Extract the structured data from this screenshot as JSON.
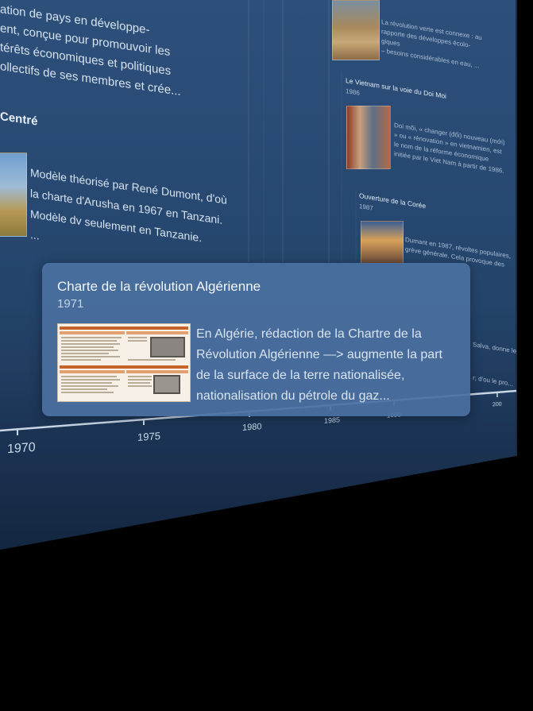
{
  "background_text": {
    "intro_lines": [
      "ation de pays en développe-",
      "ent, conçue pour promouvoir les",
      "térêts économiques et politiques",
      "ollectifs de ses membres et crée..."
    ],
    "section_heading": "Centré",
    "ujamaa_lines": [
      "Modèle théorisé par René Dumont, d'où",
      "la charte d'Arusha en 1967 en Tanzani.",
      "Modèle dv seulement en Tanzanie.",
      "..."
    ]
  },
  "right_events": [
    {
      "title": "",
      "year": "",
      "desc_lines": [
        "La révolution verte est connexe : au",
        "rapporte des développes écolo-",
        "giques",
        "– besoins considérables en eau, ..."
      ]
    },
    {
      "title": "Le Vietnam sur la voie du Doi Moi",
      "year": "1986",
      "desc_lines": [
        "Doi mõi, « changer (đổi) nouveau (mới)",
        "» ou « rénovation » en vietnamien, est",
        "le nom de la réforme économique",
        "initiée par le Viet Nam à partir de 1986."
      ]
    },
    {
      "title": "Ouverture de la Corée",
      "year": "1987",
      "desc_lines": [
        "Dumant en 1987, révoltes populaires,",
        "grève générale. Cela provoque des"
      ]
    }
  ],
  "edge_snippets": [
    "Salva, donne le",
    "r; d'ou le pro..."
  ],
  "timeline": {
    "ticks": [
      "1970",
      "1975",
      "1980",
      "1985",
      "1990",
      "200"
    ]
  },
  "card": {
    "title": "Charte de la révolution Algérienne",
    "year": "1971",
    "description": "En Algérie, rédaction de la Chartre de la Révolution Algérienne —> augmente la part de la surface de la terre nationalisée, nationalisation du pétrole du gaz..."
  },
  "colors": {
    "panel_top": "#2b4f7a",
    "panel_bottom": "#1a314f",
    "card_bg": "#4a70a0",
    "outside": "#000000"
  }
}
